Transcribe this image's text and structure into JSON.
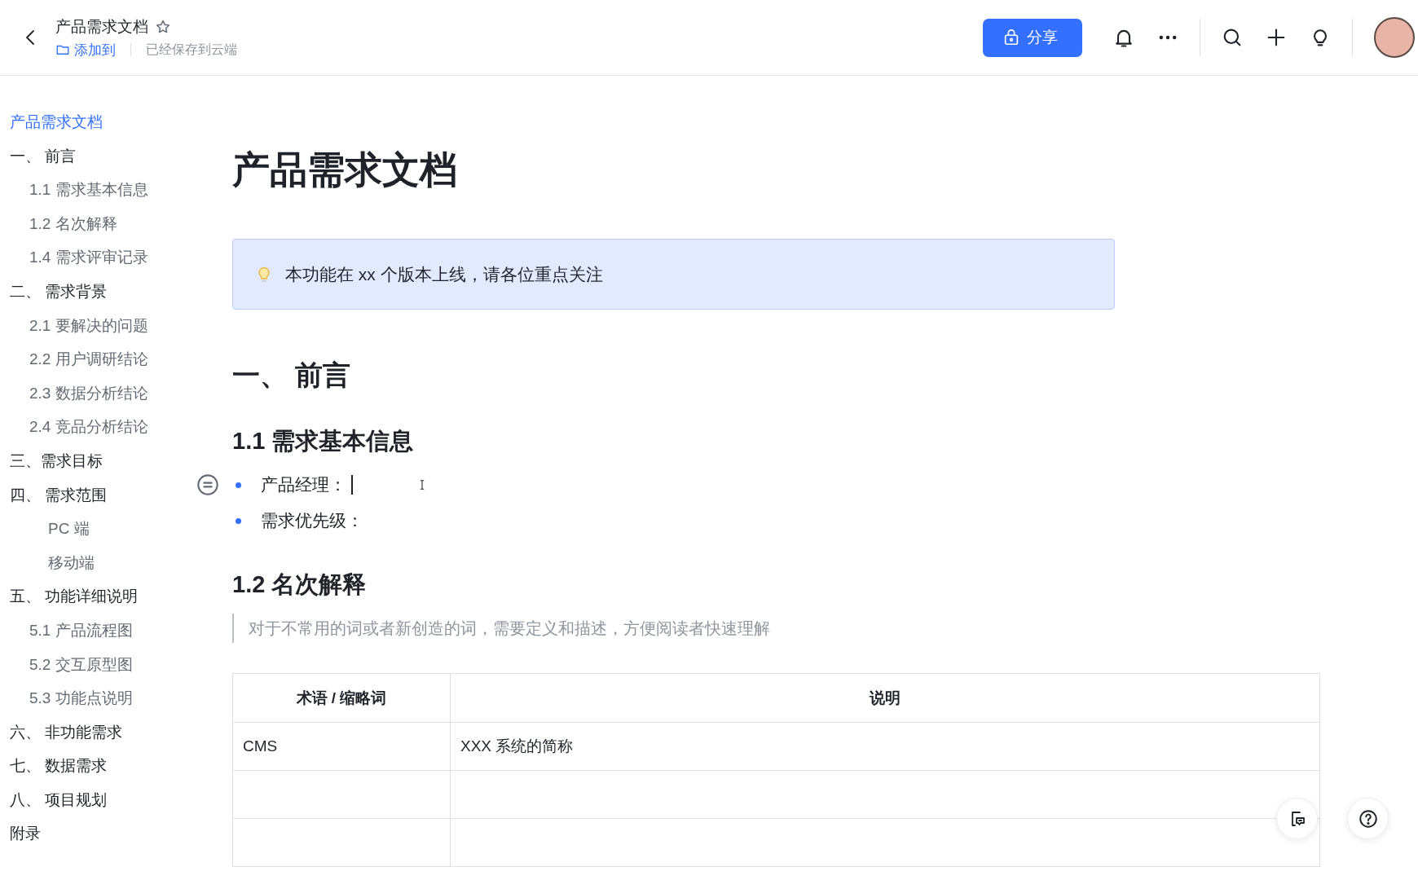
{
  "header": {
    "title": "产品需求文档",
    "add_to": "添加到",
    "save_status": "已经保存到云端",
    "share_button": "分享"
  },
  "outline": {
    "items": [
      {
        "label": "产品需求文档",
        "selected": true
      },
      {
        "label": "一、 前言",
        "selected": false,
        "children": [
          {
            "label": "1.1 需求基本信息",
            "selected": false,
            "kind": "numbered"
          },
          {
            "label": "1.2 名次解释",
            "selected": false,
            "kind": "numbered"
          },
          {
            "label": "1.4 需求评审记录",
            "selected": false,
            "kind": "numbered"
          }
        ]
      },
      {
        "label": "二、 需求背景",
        "selected": false,
        "children": [
          {
            "label": "2.1 要解决的问题",
            "selected": false,
            "kind": "numbered"
          },
          {
            "label": "2.2 用户调研结论",
            "selected": false,
            "kind": "numbered"
          },
          {
            "label": "2.3 数据分析结论",
            "selected": false,
            "kind": "numbered"
          },
          {
            "label": "2.4 竞品分析结论",
            "selected": false,
            "kind": "numbered"
          }
        ]
      },
      {
        "label": "三、需求目标",
        "selected": false
      },
      {
        "label": "四、 需求范围",
        "selected": false,
        "children": [
          {
            "label": "PC 端",
            "selected": false,
            "kind": "plain"
          },
          {
            "label": "移动端",
            "selected": false,
            "kind": "plain"
          }
        ]
      },
      {
        "label": "五、 功能详细说明",
        "selected": false,
        "children": [
          {
            "label": "5.1 产品流程图",
            "selected": false,
            "kind": "numbered"
          },
          {
            "label": "5.2 交互原型图",
            "selected": false,
            "kind": "numbered"
          },
          {
            "label": "5.3 功能点说明",
            "selected": false,
            "kind": "numbered"
          }
        ]
      },
      {
        "label": "六、 非功能需求",
        "selected": false
      },
      {
        "label": "七、 数据需求",
        "selected": false
      },
      {
        "label": "八、 项目规划",
        "selected": false
      },
      {
        "label": "附录",
        "selected": false
      }
    ]
  },
  "document": {
    "title": "产品需求文档",
    "callout": "本功能在 xx 个版本上线，请各位重点关注",
    "blocks": [
      {
        "kind": "heading1",
        "text": "一、 前言"
      },
      {
        "kind": "heading2",
        "text": "1.1 需求基本信息"
      },
      {
        "kind": "bullet",
        "text": "产品经理：",
        "focused": true
      },
      {
        "kind": "bullet",
        "text": "需求优先级：",
        "focused": false
      },
      {
        "kind": "heading2",
        "text": "1.2 名次解释"
      },
      {
        "kind": "quote",
        "text": "对于不常用的词或者新创造的词，需要定义和描述，方便阅读者快速理解"
      },
      {
        "kind": "table",
        "columns": [
          "术语 / 缩略词",
          "说明"
        ],
        "rows": [
          {
            "term": "CMS",
            "description": "XXX 系统的简称"
          },
          {},
          {}
        ]
      }
    ]
  }
}
